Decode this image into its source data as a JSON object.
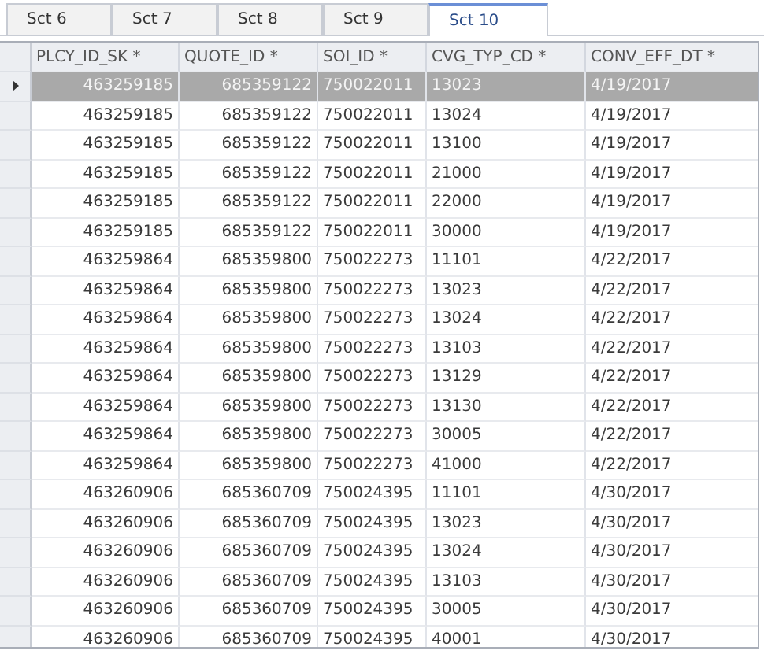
{
  "tabs": [
    {
      "label": "Sct 6",
      "selected": false
    },
    {
      "label": "Sct 7",
      "selected": false
    },
    {
      "label": "Sct 8",
      "selected": false
    },
    {
      "label": "Sct 9",
      "selected": false
    },
    {
      "label": "Sct 10",
      "selected": true
    }
  ],
  "table": {
    "columns": [
      {
        "label": "PLCY_ID_SK *"
      },
      {
        "label": "QUOTE_ID *"
      },
      {
        "label": "SOI_ID *"
      },
      {
        "label": "CVG_TYP_CD *"
      },
      {
        "label": "CONV_EFF_DT *"
      }
    ],
    "rows": [
      {
        "selected": true,
        "cells": [
          "463259185",
          "685359122",
          "750022011",
          "13023",
          "4/19/2017"
        ]
      },
      {
        "selected": false,
        "cells": [
          "463259185",
          "685359122",
          "750022011",
          "13024",
          "4/19/2017"
        ]
      },
      {
        "selected": false,
        "cells": [
          "463259185",
          "685359122",
          "750022011",
          "13100",
          "4/19/2017"
        ]
      },
      {
        "selected": false,
        "cells": [
          "463259185",
          "685359122",
          "750022011",
          "21000",
          "4/19/2017"
        ]
      },
      {
        "selected": false,
        "cells": [
          "463259185",
          "685359122",
          "750022011",
          "22000",
          "4/19/2017"
        ]
      },
      {
        "selected": false,
        "cells": [
          "463259185",
          "685359122",
          "750022011",
          "30000",
          "4/19/2017"
        ]
      },
      {
        "selected": false,
        "cells": [
          "463259864",
          "685359800",
          "750022273",
          "11101",
          "4/22/2017"
        ]
      },
      {
        "selected": false,
        "cells": [
          "463259864",
          "685359800",
          "750022273",
          "13023",
          "4/22/2017"
        ]
      },
      {
        "selected": false,
        "cells": [
          "463259864",
          "685359800",
          "750022273",
          "13024",
          "4/22/2017"
        ]
      },
      {
        "selected": false,
        "cells": [
          "463259864",
          "685359800",
          "750022273",
          "13103",
          "4/22/2017"
        ]
      },
      {
        "selected": false,
        "cells": [
          "463259864",
          "685359800",
          "750022273",
          "13129",
          "4/22/2017"
        ]
      },
      {
        "selected": false,
        "cells": [
          "463259864",
          "685359800",
          "750022273",
          "13130",
          "4/22/2017"
        ]
      },
      {
        "selected": false,
        "cells": [
          "463259864",
          "685359800",
          "750022273",
          "30005",
          "4/22/2017"
        ]
      },
      {
        "selected": false,
        "cells": [
          "463259864",
          "685359800",
          "750022273",
          "41000",
          "4/22/2017"
        ]
      },
      {
        "selected": false,
        "cells": [
          "463260906",
          "685360709",
          "750024395",
          "11101",
          "4/30/2017"
        ]
      },
      {
        "selected": false,
        "cells": [
          "463260906",
          "685360709",
          "750024395",
          "13023",
          "4/30/2017"
        ]
      },
      {
        "selected": false,
        "cells": [
          "463260906",
          "685360709",
          "750024395",
          "13024",
          "4/30/2017"
        ]
      },
      {
        "selected": false,
        "cells": [
          "463260906",
          "685360709",
          "750024395",
          "13103",
          "4/30/2017"
        ]
      },
      {
        "selected": false,
        "cells": [
          "463260906",
          "685360709",
          "750024395",
          "30005",
          "4/30/2017"
        ]
      },
      {
        "selected": false,
        "cells": [
          "463260906",
          "685360709",
          "750024395",
          "40001",
          "4/30/2017"
        ]
      }
    ]
  }
}
